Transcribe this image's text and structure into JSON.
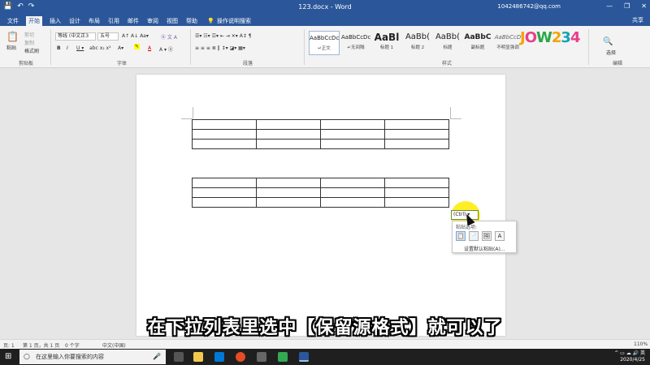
{
  "titlebar": {
    "undo_icon": "undo-icon",
    "redo_icon": "redo-icon",
    "save_icon": "save-icon",
    "title": "123.docx - Word",
    "account": "1042486742@qq.com",
    "minimize": "—",
    "restore": "❐",
    "close": "✕"
  },
  "tabs": {
    "file": "文件",
    "home": "开始",
    "insert": "插入",
    "design": "设计",
    "layout": "布局",
    "references": "引用",
    "mailings": "邮件",
    "review": "审阅",
    "view": "视图",
    "help": "帮助",
    "tellme": "操作说明搜索",
    "share": "共享"
  },
  "ribbon": {
    "clipboard": {
      "paste": "粘贴",
      "cut": "剪切",
      "copy": "复制",
      "format_painter": "格式刷",
      "label": "剪贴板"
    },
    "font": {
      "font_name": "等线 (中文正3",
      "font_size": "五号",
      "label": "字体"
    },
    "paragraph": {
      "label": "段落"
    },
    "styles": {
      "label": "样式",
      "items": [
        {
          "preview": "AaBbCcDc",
          "name": "↵正文"
        },
        {
          "preview": "AaBbCcDc",
          "name": "↵无间隔"
        },
        {
          "preview": "AaBl",
          "name": "标题 1"
        },
        {
          "preview": "AaBb(",
          "name": "标题 2"
        },
        {
          "preview": "AaBb(",
          "name": "标题"
        },
        {
          "preview": "AaBbC",
          "name": "副标题"
        },
        {
          "preview": "AaBbCcD",
          "name": "不明显强调"
        }
      ]
    },
    "editing": {
      "label": "编辑",
      "select": "选择"
    }
  },
  "paste_options": {
    "badge": "(Ctrl) ▾",
    "title": "粘贴选项:",
    "options": [
      "keep-source-formatting",
      "merge-formatting",
      "picture",
      "keep-text-only"
    ],
    "set_default": "设置默认粘贴(A)..."
  },
  "subtitle": "在下拉列表里选中【保留源格式】就可以了",
  "statusbar": {
    "page": "页: 1",
    "pages": "第 1 页，共 1 页",
    "words": "0 个字",
    "language": "中文(中国)",
    "zoom": "110%"
  },
  "taskbar": {
    "search_placeholder": "在这里输入你要搜索的内容",
    "time": "2020/4/25"
  },
  "watermark": "JOW234",
  "colors": {
    "word_blue": "#2b579a",
    "highlight_yellow": "#ffeb00"
  }
}
